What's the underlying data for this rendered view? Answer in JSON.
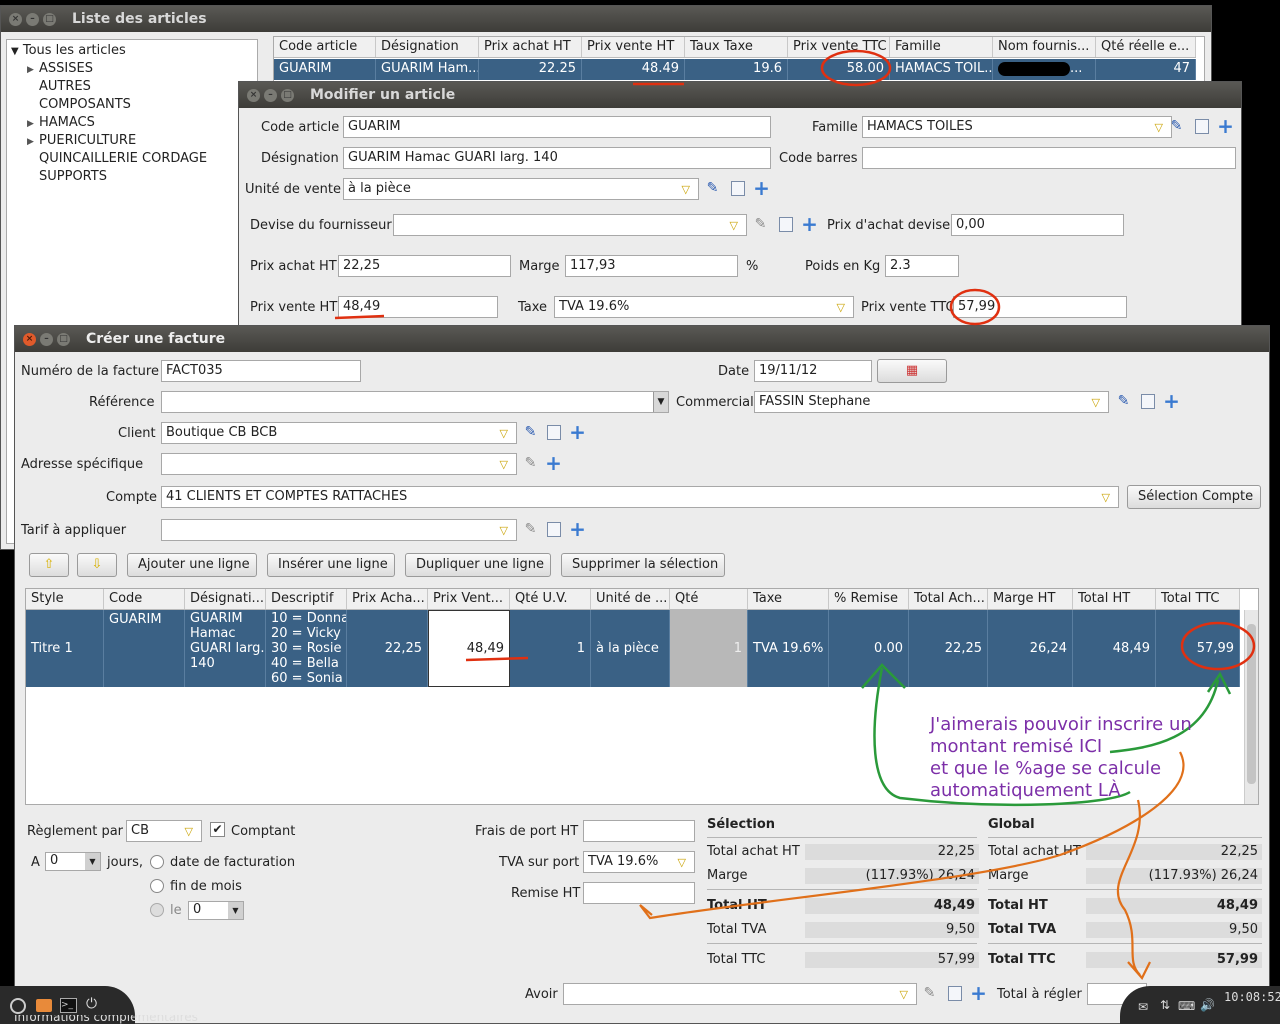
{
  "win1": {
    "title": "Liste des articles",
    "tree": {
      "root": "Tous les articles",
      "items": [
        "ASSISES",
        "AUTRES",
        "COMPOSANTS",
        "HAMACS",
        "PUERICULTURE",
        "QUINCAILLERIE CORDAGE",
        "SUPPORTS"
      ],
      "expandable": [
        true,
        false,
        false,
        true,
        true,
        false,
        false
      ]
    },
    "columns": [
      "Code article",
      "Désignation",
      "Prix achat HT",
      "Prix vente HT",
      "Taux Taxe",
      "Prix vente TTC",
      "Famille",
      "Nom fournis...",
      "Qté réelle e..."
    ],
    "row": [
      "GUARIM",
      "GUARIM Ham...",
      "22.25",
      "48.49",
      "19.6",
      "58.00",
      "HAMACS TOIL...",
      "...",
      "47"
    ]
  },
  "win2": {
    "title": "Modifier un article",
    "code_label": "Code article",
    "code": "GUARIM",
    "famille_label": "Famille",
    "famille": "HAMACS TOILES",
    "designation_label": "Désignation",
    "designation": "GUARIM Hamac GUARI larg. 140",
    "barcode_label": "Code barres",
    "barcode": "",
    "unite_label": "Unité de vente",
    "unite": "à la pièce",
    "devise_label": "Devise du fournisseur",
    "devise": "",
    "prix_devise_label": "Prix d'achat devise",
    "prix_devise": "0,00",
    "achat_label": "Prix achat HT",
    "achat": "22,25",
    "marge_label": "Marge",
    "marge": "117,93",
    "pct": "%",
    "poids_label": "Poids en Kg",
    "poids": "2.3",
    "vente_ht_label": "Prix vente HT",
    "vente_ht": "48,49",
    "taxe_label": "Taxe",
    "taxe": "TVA 19.6%",
    "vente_ttc_label": "Prix vente TTC",
    "vente_ttc": "57,99"
  },
  "win3": {
    "title": "Créer une facture",
    "numero_label": "Numéro de la facture",
    "numero": "FACT035",
    "date_label": "Date",
    "date": "19/11/12",
    "reference_label": "Référence",
    "reference": "",
    "commercial_label": "Commercial",
    "commercial": "FASSIN Stephane",
    "client_label": "Client",
    "client": "Boutique CB BCB",
    "adresse_label": "Adresse spécifique",
    "adresse": "",
    "compte_label": "Compte",
    "compte": "41 CLIENTS ET COMPTES RATTACHES",
    "selection_compte": "Sélection Compte",
    "tarif_label": "Tarif à appliquer",
    "tarif": "",
    "buttons": [
      "Ajouter une ligne",
      "Insérer une ligne",
      "Dupliquer une ligne",
      "Supprimer la sélection"
    ],
    "columns": [
      "Style",
      "Code",
      "Désignati...",
      "Descriptif",
      "Prix Acha...",
      "Prix Vent...",
      "Qté U.V.",
      "Unité de ...",
      "Qté",
      "Taxe",
      "% Remise",
      "Total Ach...",
      "Marge HT",
      "Total HT",
      "Total TTC"
    ],
    "line": {
      "style": "Titre 1",
      "code": "GUARIM",
      "designation": [
        "GUARIM",
        "Hamac",
        "GUARI larg.",
        "140"
      ],
      "descriptif": [
        "10 = Donna",
        "20 = Vicky",
        "30 = Rosie",
        "40 = Bella",
        "60 = Sonia"
      ],
      "prix_achat": "22,25",
      "prix_vente": "48,49",
      "qte_uv": "1",
      "unite": "à la pièce",
      "qte": "1",
      "taxe": "TVA 19.6%",
      "remise": "0.00",
      "total_achat": "22,25",
      "marge": "26,24",
      "total_ht": "48,49",
      "total_ttc": "57,99"
    },
    "reglement_label": "Règlement par",
    "reglement": "CB",
    "comptant": "Comptant",
    "a_label": "A",
    "a_value": "0",
    "jours": "jours,",
    "opt_facturation": "date de facturation",
    "opt_fin_mois": "fin de mois",
    "opt_le": "le",
    "le_value": "0",
    "frais_port_label": "Frais de port HT",
    "tva_port_label": "TVA sur port",
    "tva_port": "TVA 19.6%",
    "remise_ht_label": "Remise HT",
    "selection": {
      "title": "Sélection",
      "achat_label": "Total achat HT",
      "achat": "22,25",
      "marge_label": "Marge",
      "marge": "(117.93%) 26,24",
      "ht_label": "Total HT",
      "ht": "48,49",
      "tva_label": "Total TVA",
      "tva": "9,50",
      "ttc_label": "Total TTC",
      "ttc": "57,99"
    },
    "global": {
      "title": "Global",
      "achat_label": "Total achat HT",
      "achat": "22,25",
      "marge_label": "Marge",
      "marge": "(117.93%) 26,24",
      "ht_label": "Total HT",
      "ht": "48,49",
      "tva_label": "Total TVA",
      "tva": "9,50",
      "ttc_label": "Total TTC",
      "ttc": "57,99",
      "regler_label": "Total à régler"
    },
    "avoir_label": "Avoir"
  },
  "annotation": [
    "J'aimerais pouvoir inscrire un",
    "montant remisé ICI",
    "et que le %age se calcule",
    "automatiquement LÀ"
  ],
  "taskbar": {
    "clock": "10:08:52",
    "footer": "Informations complémentaires"
  },
  "colors": {
    "selection": "#3a6185",
    "titlebar": "#3d3c38",
    "close_button": "#e05a2b",
    "annotation_red": "#e03010",
    "annotation_green": "#2a9a3a",
    "annotation_orange": "#e0701a",
    "annotation_purple": "#7c2fa8"
  }
}
